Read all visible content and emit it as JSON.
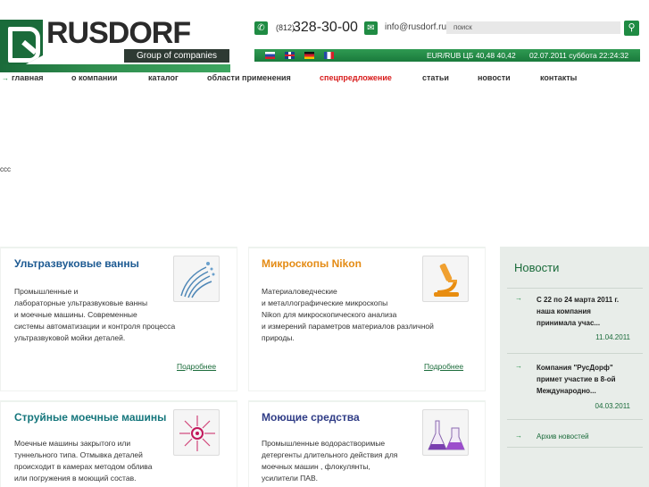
{
  "logo": {
    "brand": "RUSDORF",
    "subtitle": "Group of companies"
  },
  "contact": {
    "phone_code": "(812)",
    "phone_number": "328-30-00",
    "email": "info@rusdorf.ru",
    "search_placeholder": "поиск"
  },
  "info_bar": {
    "languages": [
      "ru",
      "en",
      "de",
      "fr"
    ],
    "rate": "EUR/RUB  ЦБ   40,48  40,42",
    "date": "02.07.2011 суббота 22:24:32"
  },
  "nav": {
    "items": [
      {
        "label": "главная"
      },
      {
        "label": "о компании"
      },
      {
        "label": "каталог"
      },
      {
        "label": "области применения"
      },
      {
        "label": "спецпредложение"
      },
      {
        "label": "статьи"
      },
      {
        "label": "новости"
      },
      {
        "label": "контакты"
      }
    ]
  },
  "placeholder_text": "ccc",
  "cards": [
    {
      "title": "Ультразвуковые ванны",
      "description": "Промышленные и\nлабораторные ультразвуковые ванны\nи моечные машины. Современные\nсистемы автоматизации и контроля процесса\nультразвуковой мойки деталей.",
      "more": "Подробнее",
      "icon": "ultrasound-bath-icon"
    },
    {
      "title": "Микроскопы Nikon",
      "description": "Материаловедческие\nи металлографические микроскопы\nNikon для микроскопического анализа\nи измерений параметров материалов различной\nприроды.",
      "more": "Подробнее",
      "icon": "microscope-icon"
    },
    {
      "title": "Струйные моечные машины",
      "description": "Моечные машины закрытого или\nтуннельного типа. Отмывка деталей\nпроисходит в камерах методом облива\nили погружения в моющий состав.",
      "icon": "spray-washer-icon"
    },
    {
      "title": "Моющие средства",
      "description": "Промышленные водорастворимые\nдетергенты длительного действия для\nмоечных машин , флокулянты,\nусилители ПАВ.",
      "icon": "chemical-flask-icon"
    }
  ],
  "news": {
    "title": "Новости",
    "items": [
      {
        "text": "С 22 по 24 марта 2011 г.\nнаша компания\nпринимала учас...",
        "date": "11.04.2011"
      },
      {
        "text": "Компания \"РусДорф\"\nпримет участие в 8-ой\nМеждународно...",
        "date": "04.03.2011"
      }
    ],
    "archive": "Архив новостей"
  }
}
